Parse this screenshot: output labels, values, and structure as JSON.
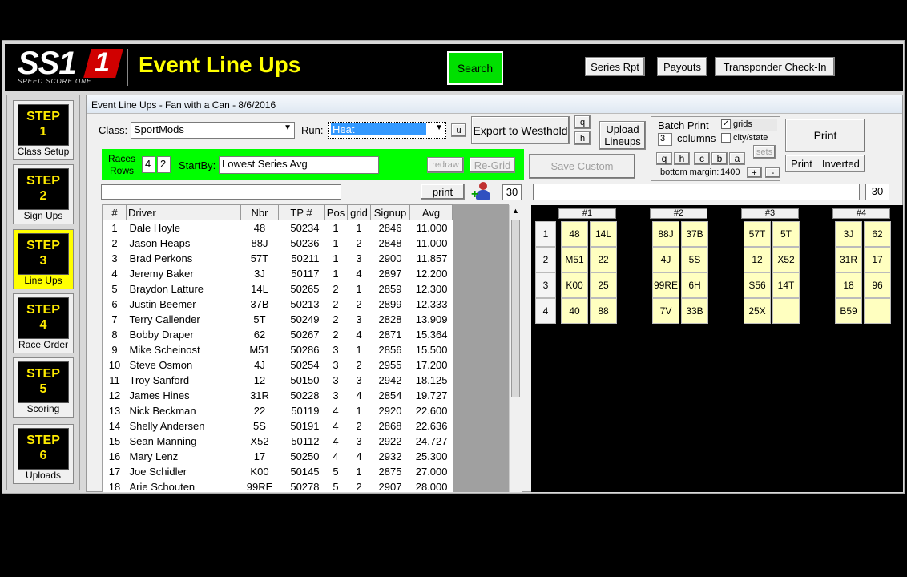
{
  "header": {
    "logo_text": "SS1",
    "logo_sub": "SPEED SCORE ONE",
    "title": "Event Line Ups",
    "search_label": "Search",
    "series_rpt_label": "Series Rpt",
    "payouts_label": "Payouts",
    "transponder_label": "Transponder Check-In"
  },
  "steps": [
    {
      "label": "STEP",
      "num": "1",
      "caption": "Class Setup"
    },
    {
      "label": "STEP",
      "num": "2",
      "caption": "Sign Ups"
    },
    {
      "label": "STEP",
      "num": "3",
      "caption": "Line Ups"
    },
    {
      "label": "STEP",
      "num": "4",
      "caption": "Race Order"
    },
    {
      "label": "STEP",
      "num": "5",
      "caption": "Scoring"
    },
    {
      "label": "STEP",
      "num": "6",
      "caption": "Uploads"
    }
  ],
  "panel": {
    "title": "Event Line Ups - Fan with a Can - 8/6/2016",
    "class_label": "Class:",
    "class_value": "SportMods",
    "run_label": "Run:",
    "run_value": "Heat",
    "u_label": "u",
    "export_label": "Export to Westhold",
    "q_label": "q",
    "h_label": "h",
    "upload_label_1": "Upload",
    "upload_label_2": "Lineups",
    "races_label": "Races",
    "rows_label": "Rows",
    "races_value": "4",
    "rows_value": "2",
    "startby_label": "StartBy:",
    "startby_value": "Lowest Series Avg",
    "redraw_label": "redraw",
    "regrid_label": "Re-Grid",
    "save_custom_label": "Save Custom",
    "print_small_label": "print",
    "count_left": "30",
    "count_right": "30",
    "batch": {
      "title": "Batch Print",
      "columns_value": "3",
      "columns_label": "columns",
      "grids_label": "grids",
      "grids_check": "✓",
      "citystate_label": "city/state",
      "sets_label": "sets",
      "btn_q": "q",
      "btn_h": "h",
      "btn_c": "c",
      "btn_b": "b",
      "btn_a": "a",
      "margin_label": "bottom margin:",
      "margin_value": "1400",
      "plus": "+",
      "minus": "-"
    },
    "print_label": "Print",
    "print_inverted_1": "Print",
    "print_inverted_2": "Inverted"
  },
  "table": {
    "headers": [
      "#",
      "Driver",
      "Nbr",
      "TP #",
      "Pos",
      "grid",
      "Signup",
      "Avg"
    ],
    "rows": [
      [
        "1",
        "Dale Hoyle",
        "48",
        "50234",
        "1",
        "1",
        "2846",
        "11.000"
      ],
      [
        "2",
        "Jason Heaps",
        "88J",
        "50236",
        "1",
        "2",
        "2848",
        "11.000"
      ],
      [
        "3",
        "Brad Perkons",
        "57T",
        "50211",
        "1",
        "3",
        "2900",
        "11.857"
      ],
      [
        "4",
        "Jeremy Baker",
        "3J",
        "50117",
        "1",
        "4",
        "2897",
        "12.200"
      ],
      [
        "5",
        "Braydon Latture",
        "14L",
        "50265",
        "2",
        "1",
        "2859",
        "12.300"
      ],
      [
        "6",
        "Justin Beemer",
        "37B",
        "50213",
        "2",
        "2",
        "2899",
        "12.333"
      ],
      [
        "7",
        "Terry Callender",
        "5T",
        "50249",
        "2",
        "3",
        "2828",
        "13.909"
      ],
      [
        "8",
        "Bobby Draper",
        "62",
        "50267",
        "2",
        "4",
        "2871",
        "15.364"
      ],
      [
        "9",
        "Mike Scheinost",
        "M51",
        "50286",
        "3",
        "1",
        "2856",
        "15.500"
      ],
      [
        "10",
        "Steve Osmon",
        "4J",
        "50254",
        "3",
        "2",
        "2955",
        "17.200"
      ],
      [
        "11",
        "Troy Sanford",
        "12",
        "50150",
        "3",
        "3",
        "2942",
        "18.125"
      ],
      [
        "12",
        "James Hines",
        "31R",
        "50228",
        "3",
        "4",
        "2854",
        "19.727"
      ],
      [
        "13",
        "Nick Beckman",
        "22",
        "50119",
        "4",
        "1",
        "2920",
        "22.600"
      ],
      [
        "14",
        "Shelly Andersen",
        "5S",
        "50191",
        "4",
        "2",
        "2868",
        "22.636"
      ],
      [
        "15",
        "Sean Manning",
        "X52",
        "50112",
        "4",
        "3",
        "2922",
        "24.727"
      ],
      [
        "16",
        "Mary Lenz",
        "17",
        "50250",
        "4",
        "4",
        "2932",
        "25.300"
      ],
      [
        "17",
        "Joe Schidler",
        "K00",
        "50145",
        "5",
        "1",
        "2875",
        "27.000"
      ],
      [
        "18",
        "Arie Schouten",
        "99RE",
        "50278",
        "5",
        "2",
        "2907",
        "28.000"
      ]
    ]
  },
  "lineup": {
    "heats": [
      "#1",
      "#2",
      "#3",
      "#4"
    ],
    "row_labels": [
      "1",
      "2",
      "3",
      "4"
    ],
    "cells": [
      [
        [
          "48",
          "14L"
        ],
        [
          "88J",
          "37B"
        ],
        [
          "57T",
          "5T"
        ],
        [
          "3J",
          "62"
        ]
      ],
      [
        [
          "M51",
          "22"
        ],
        [
          "4J",
          "5S"
        ],
        [
          "12",
          "X52"
        ],
        [
          "31R",
          "17"
        ]
      ],
      [
        [
          "K00",
          "25"
        ],
        [
          "99RE",
          "6H"
        ],
        [
          "S56",
          "14T"
        ],
        [
          "18",
          "96"
        ]
      ],
      [
        [
          "40",
          "88"
        ],
        [
          "7V",
          "33B"
        ],
        [
          "25X",
          ""
        ],
        [
          "B59",
          ""
        ]
      ]
    ]
  }
}
